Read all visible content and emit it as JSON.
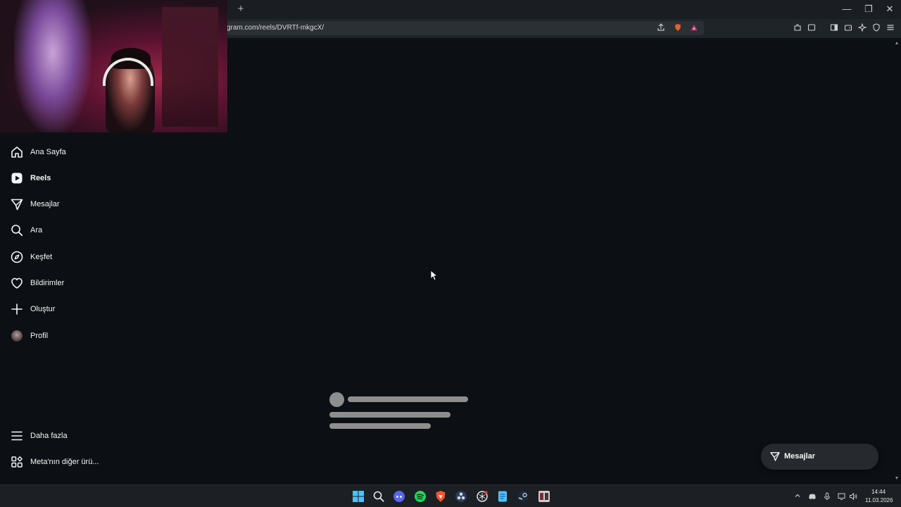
{
  "browser": {
    "new_tab": "+",
    "url": "gram.com/reels/DVRTf-mkgcX/",
    "window_controls": {
      "minimize": "—",
      "restore": "❐",
      "close": "✕"
    }
  },
  "webcam": {
    "description_icon": "webcam-overlay"
  },
  "sidebar": {
    "items": [
      {
        "label": "Ana Sayfa",
        "icon": "home-icon"
      },
      {
        "label": "Reels",
        "icon": "reels-icon",
        "active": true
      },
      {
        "label": "Mesajlar",
        "icon": "messenger-icon"
      },
      {
        "label": "Ara",
        "icon": "search-icon"
      },
      {
        "label": "Keşfet",
        "icon": "compass-icon"
      },
      {
        "label": "Bildirimler",
        "icon": "heart-icon"
      },
      {
        "label": "Oluştur",
        "icon": "plus-icon"
      },
      {
        "label": "Profil",
        "icon": "avatar"
      }
    ],
    "bottom_items": [
      {
        "label": "Daha fazla",
        "icon": "menu-icon"
      },
      {
        "label": "Meta'nın diğer ürü...",
        "icon": "meta-apps-icon"
      }
    ]
  },
  "messages_pill": {
    "label": "Mesajlar"
  },
  "taskbar": {
    "time": "14:44",
    "date": "11.03.2026"
  },
  "colors": {
    "background": "#0c1014",
    "text": "#f5f5f5",
    "skeleton": "#8e8e8e",
    "pill": "#262a2e"
  }
}
